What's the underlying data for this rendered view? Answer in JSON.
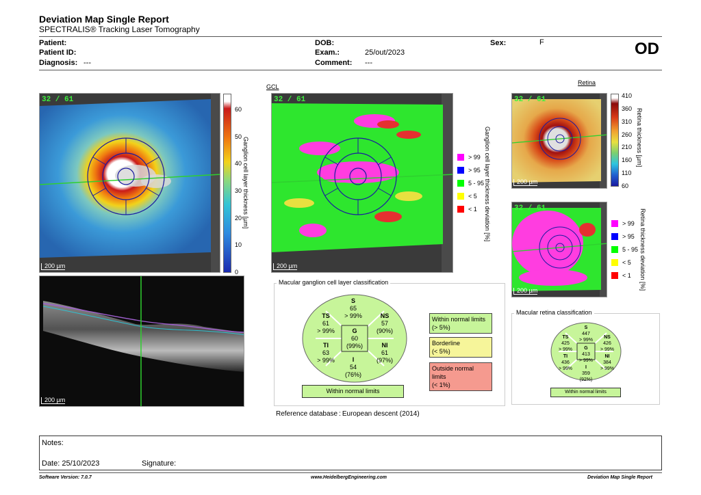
{
  "header": {
    "title": "Deviation Map Single Report",
    "subtitle": "SPECTRALIS® Tracking Laser Tomography",
    "eye": "OD"
  },
  "patient": {
    "patient_label": "Patient:",
    "patient_id_label": "Patient ID:",
    "diagnosis_label": "Diagnosis:",
    "diagnosis_value": "---",
    "dob_label": "DOB:",
    "exam_label": "Exam.:",
    "exam_value": "25/out/2023",
    "comment_label": "Comment:",
    "comment_value": "---",
    "sex_label": "Sex:",
    "sex_value": "F"
  },
  "maps": {
    "frames_label": "32 / 61",
    "scale_label": "200 µm",
    "gcl_title": "GCL",
    "retina_title": "Retina"
  },
  "gcl_thickness_scale": {
    "label": "Ganglion cell layer thickness [µm]",
    "ticks": [
      "60",
      "50",
      "40",
      "30",
      "20",
      "10",
      "0"
    ]
  },
  "gcl_deviation_legend": {
    "label": "Ganglion cell layer thickness deviation [%]",
    "items": [
      {
        "label": "> 99",
        "color": "#ff00ff"
      },
      {
        "label": "> 95",
        "color": "#0000ff"
      },
      {
        "label": "5 - 95",
        "color": "#00ff00"
      },
      {
        "label": "< 5",
        "color": "#ffff00"
      },
      {
        "label": "< 1",
        "color": "#ff0000"
      }
    ]
  },
  "retina_thickness_scale": {
    "label": "Retina thickness [µm]",
    "ticks": [
      "410",
      "360",
      "310",
      "260",
      "210",
      "160",
      "110",
      "60"
    ]
  },
  "retina_deviation_legend": {
    "label": "Retina thickness deviation [%]",
    "items": [
      {
        "label": "> 99",
        "color": "#ff00ff"
      },
      {
        "label": "> 95",
        "color": "#0000ff"
      },
      {
        "label": "5 - 95",
        "color": "#00ff00"
      },
      {
        "label": "< 5",
        "color": "#ffff00"
      },
      {
        "label": "< 1",
        "color": "#ff0000"
      }
    ]
  },
  "gcl_classification": {
    "title": "Macular ganglion cell layer classification",
    "sectors": {
      "S": {
        "name": "S",
        "value": "65",
        "pct": "> 99%"
      },
      "TS": {
        "name": "TS",
        "value": "61",
        "pct": "> 99%"
      },
      "NS": {
        "name": "NS",
        "value": "57",
        "pct": "(90%)"
      },
      "G": {
        "name": "G",
        "value": "60",
        "pct": "(99%)"
      },
      "TI": {
        "name": "TI",
        "value": "63",
        "pct": "> 99%"
      },
      "NI": {
        "name": "NI",
        "value": "61",
        "pct": "(97%)"
      },
      "I": {
        "name": "I",
        "value": "54",
        "pct": "(76%)"
      }
    },
    "result": "Within normal limits",
    "status_wnl": {
      "line1": "Within normal limits",
      "line2": "(> 5%)"
    },
    "status_bl": {
      "line1": "Borderline",
      "line2": "(< 5%)"
    },
    "status_onl": {
      "line1": "Outside normal limits",
      "line2": "(< 1%)"
    },
    "reference": "Reference database : European descent (2014)"
  },
  "retina_classification": {
    "title": "Macular retina classification",
    "sectors": {
      "S": {
        "name": "S",
        "value": "447",
        "pct": "> 99%"
      },
      "TS": {
        "name": "TS",
        "value": "425",
        "pct": "> 99%"
      },
      "NS": {
        "name": "NS",
        "value": "426",
        "pct": "> 99%"
      },
      "G": {
        "name": "G",
        "value": "413",
        "pct": "> 99%"
      },
      "TI": {
        "name": "TI",
        "value": "436",
        "pct": "> 99%"
      },
      "NI": {
        "name": "NI",
        "value": "384",
        "pct": "> 99%"
      },
      "I": {
        "name": "I",
        "value": "359",
        "pct": "(92%)"
      }
    },
    "result": "Within normal limits"
  },
  "notes": {
    "notes_label": "Notes:",
    "date_label": "Date: 25/10/2023",
    "signature_label": "Signature:"
  },
  "footer": {
    "software": "Software Version: 7.0.7",
    "website": "www.HeidelbergEngineering.com",
    "report": "Deviation Map Single Report"
  },
  "colors": {
    "wnl": "#c7f59a",
    "borderline": "#f6f59a",
    "outside": "#f59a8f",
    "green_line": "#2fd02f",
    "grid_blue": "#1a1aa0"
  }
}
